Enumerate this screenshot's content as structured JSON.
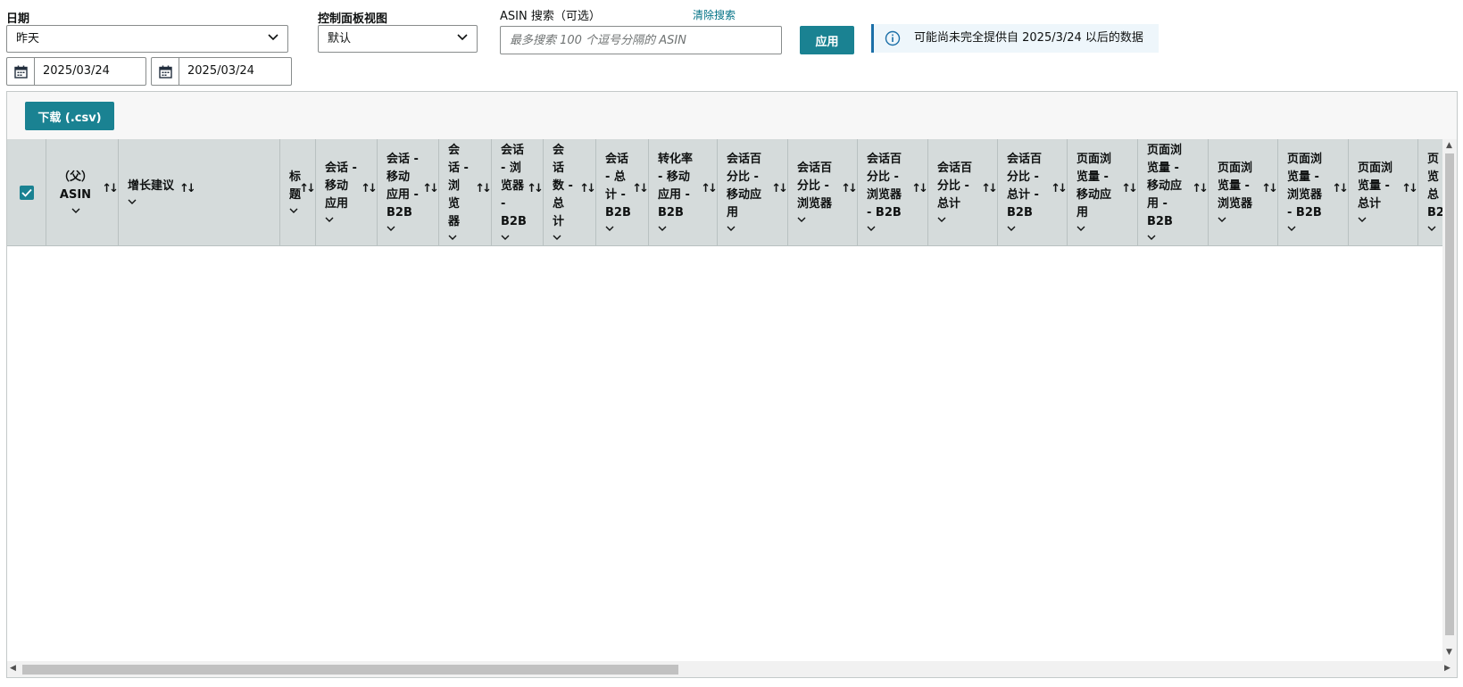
{
  "filters": {
    "date_label": "日期",
    "date_range_value": "昨天",
    "start_date": "2025/03/24",
    "end_date": "2025/03/24",
    "dashboard_view_label": "控制面板视图",
    "dashboard_view_value": "默认",
    "asin_search_label": "ASIN 搜索（可选）",
    "clear_search_label": "清除搜索",
    "asin_search_placeholder": "最多搜索 100 个逗号分隔的 ASIN",
    "apply_label": "应用"
  },
  "info_notice": "可能尚未完全提供自 2025/3/24 以后的数据",
  "toolbar": {
    "download_label": "下载 (.csv)"
  },
  "colors": {
    "accent": "#1a8292",
    "link": "#007185",
    "header_bg": "#d5dbdb",
    "info_bg": "#eef6fb"
  },
  "table": {
    "select_all_checked": true,
    "headers": [
      "（父）\nASIN",
      "增长建议",
      "标\n题",
      "会话 -\n移动\n应用",
      "会话 -\n移动\n应用 -\nB2B",
      "会\n话 -\n浏\n览\n器",
      "会话\n- 浏\n览器\n-\nB2B",
      "会\n话\n数 -\n总\n计",
      "会话\n- 总\n计 -\nB2B",
      "转化率\n- 移动\n应用 -\nB2B",
      "会话百\n分比 -\n移动应\n用",
      "会话百\n分比 -\n浏览器",
      "会话百\n分比 -\n浏览器\n- B2B",
      "会话百\n分比 -\n总计",
      "会话百\n分比 -\n总计 -\nB2B",
      "页面浏\n览量 -\n移动应\n用",
      "页面浏\n览量 -\n移动应\n用 -\nB2B",
      "页面浏\n览量 -\n浏览器",
      "页面浏\n览量 -\n浏览器\n- B2B",
      "页面浏\n览量 -\n总计",
      "页\n览\n总\nB2"
    ]
  }
}
